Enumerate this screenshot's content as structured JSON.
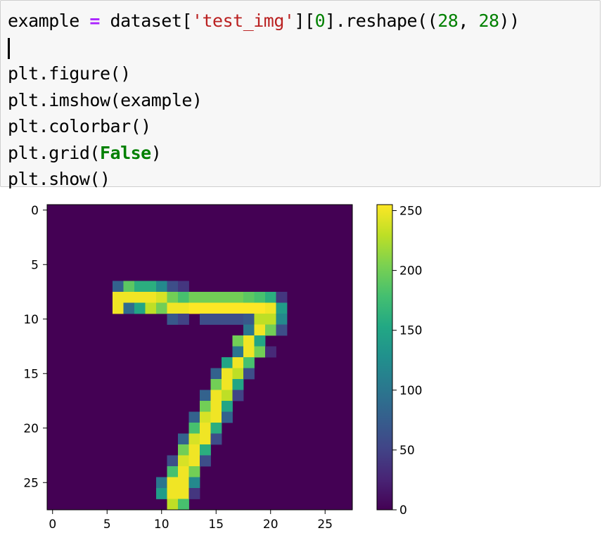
{
  "code_cell": {
    "lines": [
      [
        {
          "t": "example ",
          "c": ""
        },
        {
          "t": "=",
          "c": "op"
        },
        {
          "t": " dataset[",
          "c": ""
        },
        {
          "t": "'test_img'",
          "c": "str"
        },
        {
          "t": "][",
          "c": ""
        },
        {
          "t": "0",
          "c": "num"
        },
        {
          "t": "].reshape((",
          "c": ""
        },
        {
          "t": "28",
          "c": "num"
        },
        {
          "t": ", ",
          "c": ""
        },
        {
          "t": "28",
          "c": "num"
        },
        {
          "t": "))",
          "c": ""
        }
      ],
      [],
      [
        {
          "t": "plt.figure()",
          "c": ""
        }
      ],
      [
        {
          "t": "plt.imshow(example)",
          "c": ""
        }
      ],
      [
        {
          "t": "plt.colorbar()",
          "c": ""
        }
      ],
      [
        {
          "t": "plt.grid(",
          "c": ""
        },
        {
          "t": "False",
          "c": "kw"
        },
        {
          "t": ")",
          "c": ""
        }
      ],
      [
        {
          "t": "plt.show()",
          "c": ""
        }
      ]
    ]
  },
  "chart_data": {
    "type": "heatmap",
    "title": "",
    "xlabel": "",
    "ylabel": "",
    "xticks": [
      "0",
      "5",
      "10",
      "15",
      "20",
      "25"
    ],
    "yticks": [
      "0",
      "5",
      "10",
      "15",
      "20",
      "25"
    ],
    "xlim": [
      -0.5,
      27.5
    ],
    "ylim": [
      27.5,
      -0.5
    ],
    "colormap": "viridis",
    "colorbar": {
      "ticks": [
        "0",
        "50",
        "100",
        "150",
        "200",
        "250"
      ],
      "range": [
        0,
        255
      ]
    },
    "grid": false,
    "values_nonzero": [
      {
        "row": 7,
        "cols": [
          [
            6,
            80
          ],
          [
            7,
            190
          ],
          [
            8,
            160
          ],
          [
            9,
            160
          ],
          [
            10,
            120
          ],
          [
            11,
            60
          ],
          [
            12,
            40
          ]
        ]
      },
      {
        "row": 8,
        "cols": [
          [
            6,
            250
          ],
          [
            7,
            250
          ],
          [
            8,
            250
          ],
          [
            9,
            250
          ],
          [
            10,
            240
          ],
          [
            11,
            200
          ],
          [
            12,
            180
          ],
          [
            13,
            200
          ],
          [
            14,
            200
          ],
          [
            15,
            200
          ],
          [
            16,
            200
          ],
          [
            17,
            200
          ],
          [
            18,
            190
          ],
          [
            19,
            180
          ],
          [
            20,
            160
          ],
          [
            21,
            40
          ]
        ]
      },
      {
        "row": 9,
        "cols": [
          [
            6,
            250
          ],
          [
            7,
            90
          ],
          [
            8,
            150
          ],
          [
            9,
            230
          ],
          [
            10,
            200
          ],
          [
            11,
            250
          ],
          [
            12,
            250
          ],
          [
            13,
            255
          ],
          [
            14,
            255
          ],
          [
            15,
            255
          ],
          [
            16,
            255
          ],
          [
            17,
            255
          ],
          [
            18,
            255
          ],
          [
            19,
            255
          ],
          [
            20,
            250
          ],
          [
            21,
            140
          ]
        ]
      },
      {
        "row": 10,
        "cols": [
          [
            11,
            70
          ],
          [
            12,
            50
          ],
          [
            14,
            60
          ],
          [
            15,
            60
          ],
          [
            16,
            60
          ],
          [
            17,
            60
          ],
          [
            18,
            70
          ],
          [
            19,
            230
          ],
          [
            20,
            230
          ],
          [
            21,
            120
          ]
        ]
      },
      {
        "row": 11,
        "cols": [
          [
            18,
            100
          ],
          [
            19,
            250
          ],
          [
            20,
            200
          ],
          [
            21,
            60
          ]
        ]
      },
      {
        "row": 12,
        "cols": [
          [
            17,
            200
          ],
          [
            18,
            250
          ],
          [
            19,
            150
          ]
        ]
      },
      {
        "row": 13,
        "cols": [
          [
            17,
            100
          ],
          [
            18,
            250
          ],
          [
            19,
            200
          ],
          [
            20,
            30
          ]
        ]
      },
      {
        "row": 14,
        "cols": [
          [
            16,
            150
          ],
          [
            17,
            250
          ],
          [
            18,
            180
          ]
        ]
      },
      {
        "row": 15,
        "cols": [
          [
            15,
            80
          ],
          [
            16,
            250
          ],
          [
            17,
            230
          ],
          [
            18,
            60
          ]
        ]
      },
      {
        "row": 16,
        "cols": [
          [
            15,
            200
          ],
          [
            16,
            250
          ],
          [
            17,
            150
          ]
        ]
      },
      {
        "row": 17,
        "cols": [
          [
            14,
            80
          ],
          [
            15,
            250
          ],
          [
            16,
            230
          ],
          [
            17,
            50
          ]
        ]
      },
      {
        "row": 18,
        "cols": [
          [
            14,
            200
          ],
          [
            15,
            250
          ],
          [
            16,
            150
          ]
        ]
      },
      {
        "row": 19,
        "cols": [
          [
            13,
            80
          ],
          [
            14,
            240
          ],
          [
            15,
            250
          ],
          [
            16,
            80
          ]
        ]
      },
      {
        "row": 20,
        "cols": [
          [
            13,
            180
          ],
          [
            14,
            250
          ],
          [
            15,
            160
          ]
        ]
      },
      {
        "row": 21,
        "cols": [
          [
            12,
            80
          ],
          [
            13,
            240
          ],
          [
            14,
            250
          ],
          [
            15,
            60
          ]
        ]
      },
      {
        "row": 22,
        "cols": [
          [
            12,
            200
          ],
          [
            13,
            250
          ],
          [
            14,
            160
          ]
        ]
      },
      {
        "row": 23,
        "cols": [
          [
            11,
            60
          ],
          [
            12,
            240
          ],
          [
            13,
            250
          ],
          [
            14,
            60
          ]
        ]
      },
      {
        "row": 24,
        "cols": [
          [
            11,
            180
          ],
          [
            12,
            250
          ],
          [
            13,
            200
          ]
        ]
      },
      {
        "row": 25,
        "cols": [
          [
            10,
            100
          ],
          [
            11,
            250
          ],
          [
            12,
            250
          ],
          [
            13,
            120
          ]
        ]
      },
      {
        "row": 26,
        "cols": [
          [
            10,
            140
          ],
          [
            11,
            250
          ],
          [
            12,
            250
          ],
          [
            13,
            40
          ]
        ]
      },
      {
        "row": 27,
        "cols": [
          [
            11,
            230
          ],
          [
            12,
            180
          ]
        ]
      }
    ]
  }
}
